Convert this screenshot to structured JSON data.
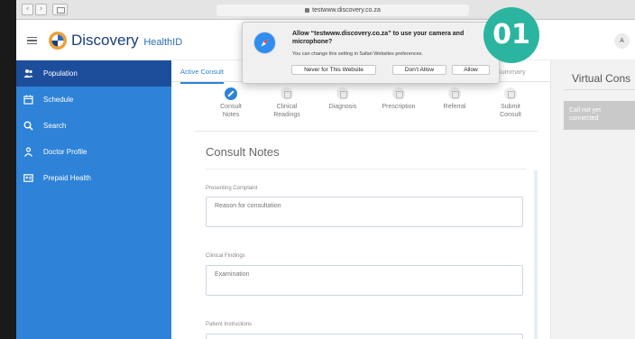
{
  "browser": {
    "url": "testwww.discovery.co.za",
    "back_glyph": "‹",
    "forward_glyph": "›"
  },
  "header": {
    "brand": "Discovery",
    "brand_sub": "HealthID",
    "avatar_initial": "A",
    "brand_color": "#1a3d7c",
    "menu_icon": "hamburger-icon",
    "logo_icon": "discovery-logo"
  },
  "sidebar": {
    "color": "#2e82d7",
    "active_color": "#1d4e9c",
    "items": [
      {
        "label": "Population",
        "icon": "people-icon",
        "active": true
      },
      {
        "label": "Schedule",
        "icon": "calendar-icon",
        "active": false
      },
      {
        "label": "Search",
        "icon": "search-icon",
        "active": false
      },
      {
        "label": "Doctor Profile",
        "icon": "person-icon",
        "active": false
      },
      {
        "label": "Prepaid Health",
        "icon": "card-icon",
        "active": false
      }
    ]
  },
  "tabs": {
    "first": "Active Consult",
    "last": "ent Summary"
  },
  "steps": [
    {
      "line1": "Consult",
      "line2": "Notes",
      "active": true
    },
    {
      "line1": "Clinical",
      "line2": "Readings",
      "active": false
    },
    {
      "line1": "Diagnosis",
      "line2": "",
      "active": false
    },
    {
      "line1": "Prescription",
      "line2": "",
      "active": false
    },
    {
      "line1": "Referral",
      "line2": "",
      "active": false
    },
    {
      "line1": "Submit",
      "line2": "Consult",
      "active": false
    }
  ],
  "consult_notes": {
    "title": "Consult Notes",
    "fields": [
      {
        "label": "Presenting Complaint",
        "placeholder": "Reason for consultation"
      },
      {
        "label": "Clinical Findings",
        "placeholder": "Examination"
      },
      {
        "label": "Patient Instructions",
        "placeholder": ""
      }
    ]
  },
  "right_panel": {
    "title": "Virtual Cons",
    "status": "Call not yet connected"
  },
  "dialog": {
    "title": "Allow “testwww.discovery.co.za” to use your camera and microphone?",
    "subtitle": "You can change this setting in Safari Websites preferences.",
    "never_label": "Never for This Website",
    "dont_allow_label": "Don’t Allow",
    "allow_label": "Allow",
    "icon": "safari-compass-icon"
  },
  "badge": {
    "label": "01",
    "color": "#2bb5a0"
  }
}
